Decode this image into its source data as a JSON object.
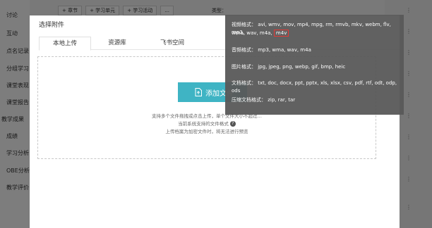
{
  "background": {
    "sidebar_items": [
      "讨论",
      "互动",
      "点名记录",
      "分组学习",
      "课堂表现",
      "课堂报告",
      "教学成果",
      "成绩",
      "学习分析",
      "OBE分析",
      "教学评价"
    ],
    "toolbar_buttons": [
      "+ 章节",
      "+ 学习单元",
      "+ 学习活动",
      "..."
    ],
    "type_label": "类型：",
    "right_dots": [
      "⋮",
      "⋮",
      "⋮",
      "⋮",
      "⋮",
      "⋮",
      "⋮",
      "⋮",
      "⋮",
      "⋮"
    ]
  },
  "modal": {
    "title": "选择附件",
    "tabs": [
      "本地上传",
      "资源库",
      "飞书空间"
    ],
    "active_tab": "本地上传",
    "upload_button": "添加文件",
    "hint_line1": "支持多个文件拖拽或点击上传，单个文件大小不超过…",
    "hint_line2": "当前系统支持的文件格式",
    "hint_line3": "上传档案为加密文件时，将无法进行预览",
    "accent_color": "#3fb4c4"
  },
  "tooltip": {
    "video_label": "视频格式：",
    "video_formats": "avi, wmv, mov, mp4, mpg, rm, rmvb, mkv, webm, flv, mp3,",
    "video_formats_2": "wma, wav, m4a,",
    "video_highlight": "m4v",
    "audio_label": "音频格式：",
    "audio_formats": "mp3, wma, wav, m4a",
    "image_label": "图片格式：",
    "image_formats": "jpg, jpeg, png, webp, gif, bmp, heic",
    "doc_label": "文档格式：",
    "doc_formats": "txt, doc, docx, ppt, pptx, xls, xlsx, csv, pdf, rtf, odt, odp, ods",
    "zip_label": "压缩文档格式：",
    "zip_formats": "zip, rar, tar"
  }
}
